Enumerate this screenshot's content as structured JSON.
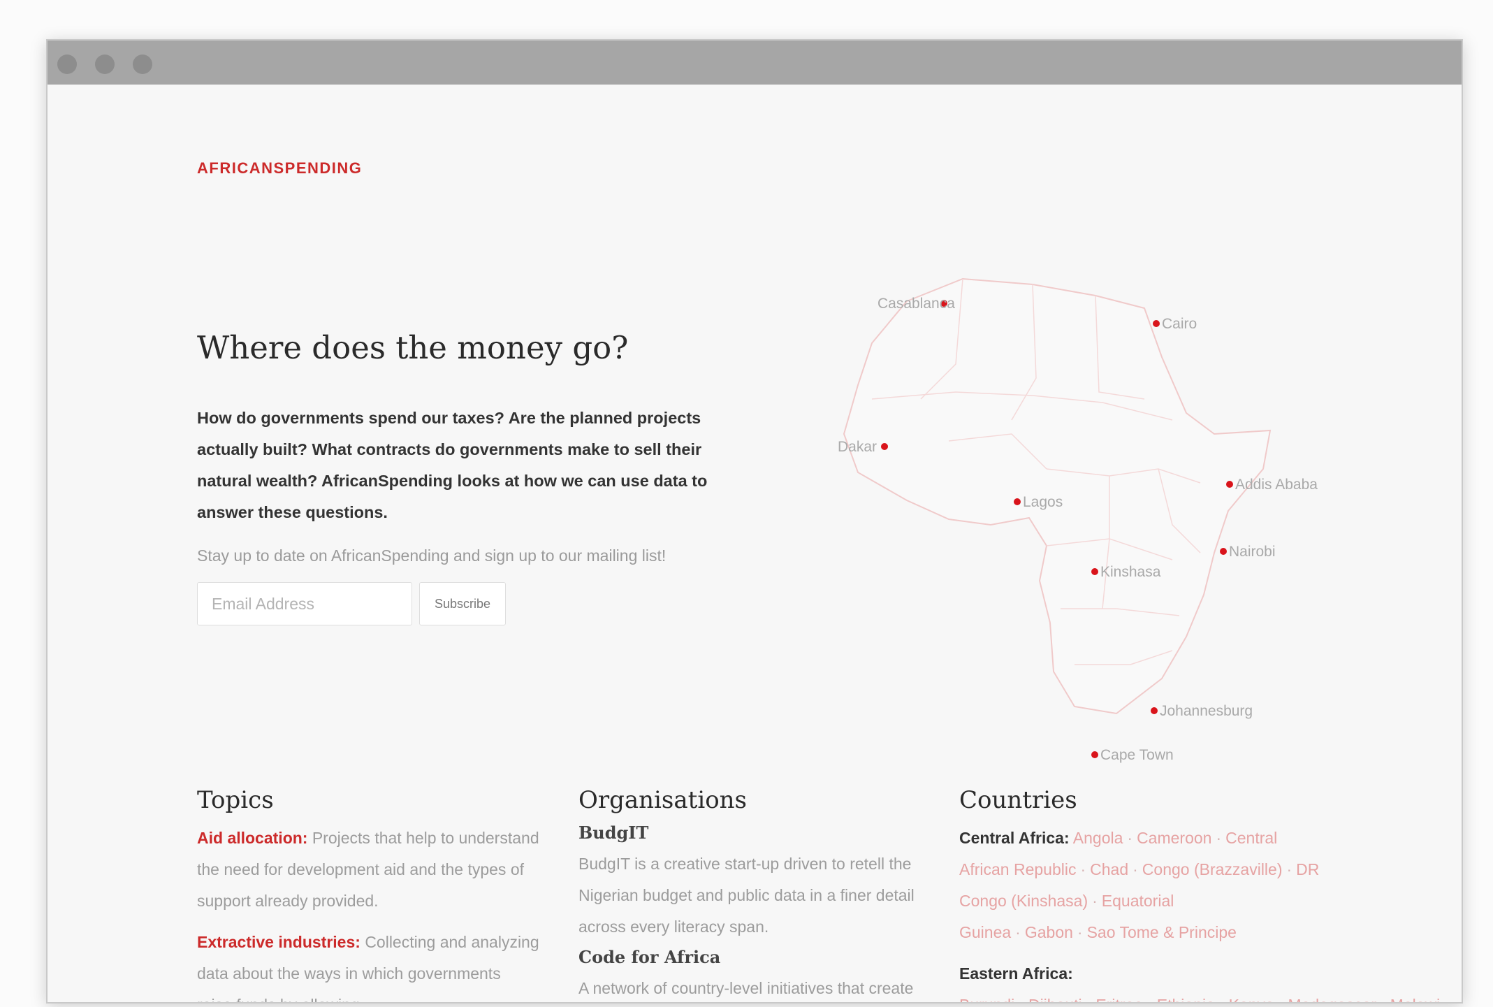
{
  "site": {
    "brand": "AFRICANSPENDING"
  },
  "hero": {
    "title": "Where does the money go?",
    "lead": "How do governments spend our taxes? Are the planned projects actually built? What contracts do governments make to sell their natural wealth? AfricanSpending looks at how we can use data to answer these questions.",
    "signup_text": "Stay up to date on AfricanSpending and sign up to our mailing list!",
    "email_placeholder": "Email Address",
    "subscribe_label": "Subscribe"
  },
  "map": {
    "cities": [
      "Casablanca",
      "Cairo",
      "Dakar",
      "Lagos",
      "Addis Ababa",
      "Nairobi",
      "Kinshasa",
      "Johannesburg",
      "Cape Town"
    ],
    "marker_color": "#d9141b"
  },
  "topics": {
    "heading": "Topics",
    "items": [
      {
        "title": "Aid allocation:",
        "text": "Projects that help to understand the need for development aid and the types of support already provided."
      },
      {
        "title": "Extractive industries:",
        "text": "Collecting and analyzing data about the ways in which governments raise funds by allowing"
      }
    ]
  },
  "organisations": {
    "heading": "Organisations",
    "items": [
      {
        "name": "BudgIT",
        "desc": "BudgIT is a creative start-up driven to retell the Nigerian budget and public data in a finer detail across every literacy span."
      },
      {
        "name": "Code for Africa",
        "desc": "A network of country-level initiatives that create demand-driven data solutions for"
      }
    ]
  },
  "countries": {
    "heading": "Countries",
    "regions": [
      {
        "name": "Central Africa:",
        "countries": [
          "Angola",
          "Cameroon",
          "Central African Republic",
          "Chad",
          "Congo (Brazzaville)",
          "DR Congo (Kinshasa)",
          "Equatorial Guinea",
          "Gabon",
          "Sao Tome & Principe"
        ]
      },
      {
        "name": "Eastern Africa:",
        "countries": [
          "Burundi",
          "Djibouti",
          "Eritrea",
          "Ethiopia",
          "Kenya",
          "Madagascar",
          "Malawi"
        ]
      }
    ]
  },
  "colors": {
    "accent": "#cc2a2a",
    "link": "#e6a3a3"
  }
}
